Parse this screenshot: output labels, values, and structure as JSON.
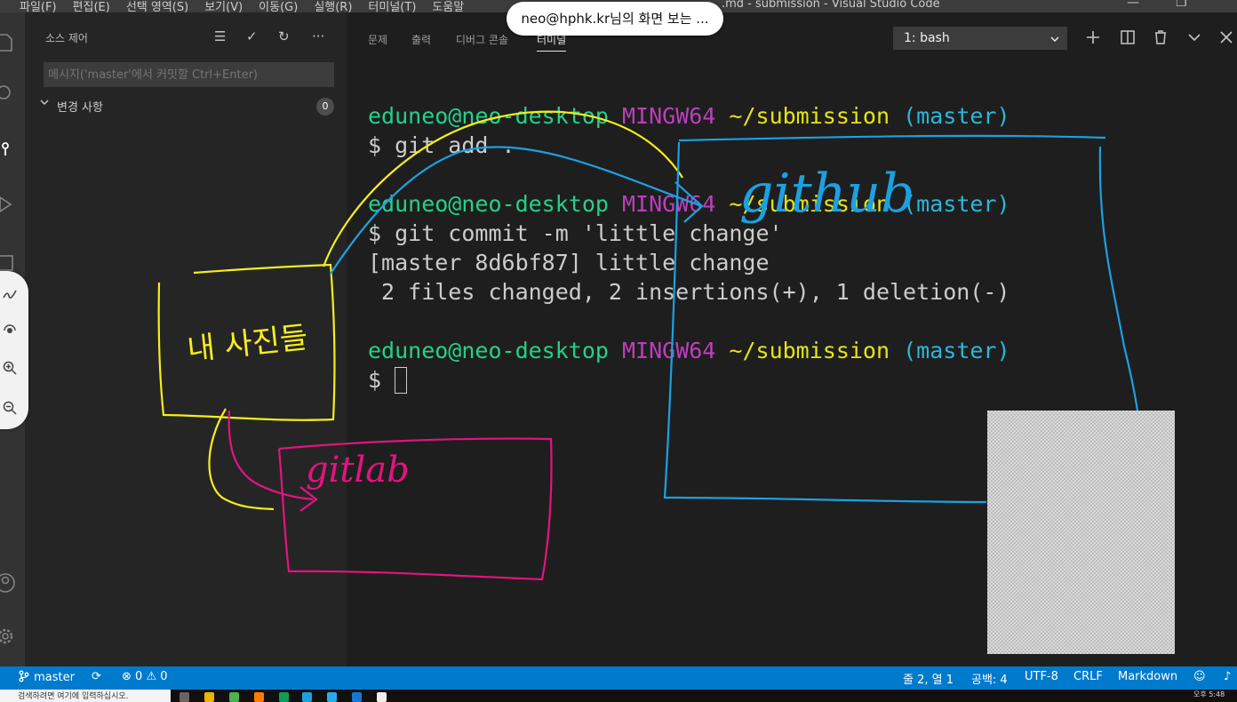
{
  "titlebar": {
    "menus": [
      "파일(F)",
      "편집(E)",
      "선택 영역(S)",
      "보기(V)",
      "이동(G)",
      "실행(R)",
      "터미널(T)",
      "도움말"
    ],
    "window_title": ".md - submission - Visual Studio Code"
  },
  "share_popup": "neo@hphk.kr님의 화면 보는 ...",
  "sidebar": {
    "title": "소스 제어",
    "commit_placeholder": "메시지('master'에서 커밋할 Ctrl+Enter)",
    "changes_label": "변경 사항",
    "changes_count": "0"
  },
  "panel": {
    "tabs": [
      "문제",
      "출력",
      "디버그 콘솔",
      "터미널"
    ],
    "active_tab": "터미널",
    "terminal_select": "1: bash"
  },
  "terminal": {
    "prompt": {
      "user": "eduneo@neo-desktop",
      "host": "MINGW64",
      "path": "~/submission",
      "branch": "(master)"
    },
    "cmd1": "$ git add .",
    "cmd2": "$ git commit -m 'little change'",
    "out1": "[master 8d6bf87] little change",
    "out2": " 2 files changed, 2 insertions(+), 1 deletion(-)",
    "cmd3": "$ "
  },
  "annotations": {
    "yellow_label": "내 사진들",
    "blue_label": "github",
    "pink_label": "gitlab",
    "colors": {
      "yellow": "#f5ee1c",
      "blue": "#1ba1e2",
      "pink": "#e3147f"
    }
  },
  "statusbar": {
    "branch": "master",
    "errors": "0",
    "warnings": "0",
    "position": "줄 2, 열 1",
    "spaces": "공백: 4",
    "encoding": "UTF-8",
    "eol": "CRLF",
    "language": "Markdown"
  },
  "taskbar": {
    "search_placeholder": "검색하려면 여기에 입력하십시오.",
    "time": "오후 5:48"
  },
  "colors": {
    "statusbar": "#007acc",
    "sidebar": "#252526",
    "editor": "#1e1e1e"
  }
}
